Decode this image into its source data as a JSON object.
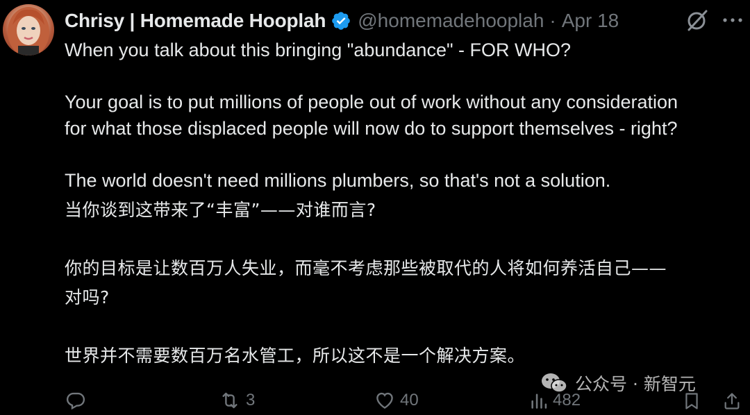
{
  "tweet": {
    "author": {
      "display_name": "Chrisy | Homemade Hooplah",
      "handle": "@homemadehooplah",
      "verified_icon": "verified-badge-icon",
      "avatar_icon": "avatar"
    },
    "separator": "·",
    "date": "Apr 18",
    "text_en": [
      "When you talk about this bringing \"abundance\" - FOR WHO?",
      "Your goal is to put millions of people out of work without any consideration",
      "for what those displaced people will now do to support themselves - right?",
      "The world doesn't need millions plumbers, so that's not a solution."
    ],
    "text_zh": [
      "当你谈到这带来了“丰富”——对谁而言?",
      "你的目标是让数百万人失业，而毫不考虑那些被取代的人将如何养活自己——",
      "对吗?",
      "世界并不需要数百万名水管工，所以这不是一个解决方案。"
    ],
    "metrics": {
      "replies": "",
      "retweets": "3",
      "likes": "40",
      "views": "482"
    }
  },
  "watermark": {
    "text": "公众号 · 新智元"
  },
  "colors": {
    "background": "#000000",
    "text": "#e7e9ea",
    "secondary": "#71767b",
    "verified": "#1d9bf0"
  }
}
